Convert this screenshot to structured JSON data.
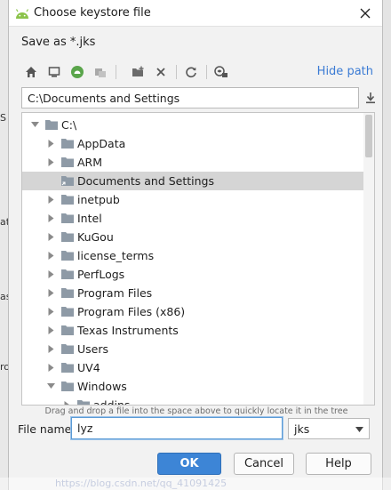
{
  "dialog": {
    "title": "Choose keystore file",
    "save_as": "Save as *.jks",
    "hide_path": "Hide path",
    "path": "C:\\Documents and Settings",
    "hint": "Drag and drop a file into the space above to quickly locate it in the tree",
    "file_name_label": "File name:",
    "file_name_value": "lyz",
    "file_type": "jks",
    "ok_label": "OK",
    "cancel_label": "Cancel",
    "help_label": "Help"
  },
  "toolbar_icons": [
    "home-icon",
    "desktop-icon",
    "android-project-icon",
    "module-icon",
    "new-folder-icon",
    "delete-icon",
    "refresh-icon",
    "show-hidden-icon"
  ],
  "tree": {
    "selected": "Documents and Settings",
    "rows": [
      {
        "label": "C:\\",
        "expanded": true,
        "level": 0
      },
      {
        "label": "AppData",
        "expanded": false,
        "level": 1
      },
      {
        "label": "ARM",
        "expanded": false,
        "level": 1
      },
      {
        "label": "Documents and Settings",
        "expanded": false,
        "level": 1,
        "link": true
      },
      {
        "label": "inetpub",
        "expanded": false,
        "level": 1
      },
      {
        "label": "Intel",
        "expanded": false,
        "level": 1
      },
      {
        "label": "KuGou",
        "expanded": false,
        "level": 1
      },
      {
        "label": "license_terms",
        "expanded": false,
        "level": 1
      },
      {
        "label": "PerfLogs",
        "expanded": false,
        "level": 1
      },
      {
        "label": "Program Files",
        "expanded": false,
        "level": 1
      },
      {
        "label": "Program Files (x86)",
        "expanded": false,
        "level": 1
      },
      {
        "label": "Texas Instruments",
        "expanded": false,
        "level": 1
      },
      {
        "label": "Users",
        "expanded": false,
        "level": 1
      },
      {
        "label": "UV4",
        "expanded": false,
        "level": 1
      },
      {
        "label": "Windows",
        "expanded": true,
        "level": 1
      },
      {
        "label": "addins",
        "expanded": false,
        "level": 2
      }
    ]
  },
  "background": {
    "watermark": "https://blog.csdn.net/qq_41091425",
    "left_fragment": "",
    "fragments": [
      "S",
      "at",
      "as",
      "ro"
    ]
  },
  "colors": {
    "accent": "#3d85d6",
    "link": "#3b7bd4",
    "folder": "#8e9aa6",
    "selection": "#d5d5d5"
  }
}
